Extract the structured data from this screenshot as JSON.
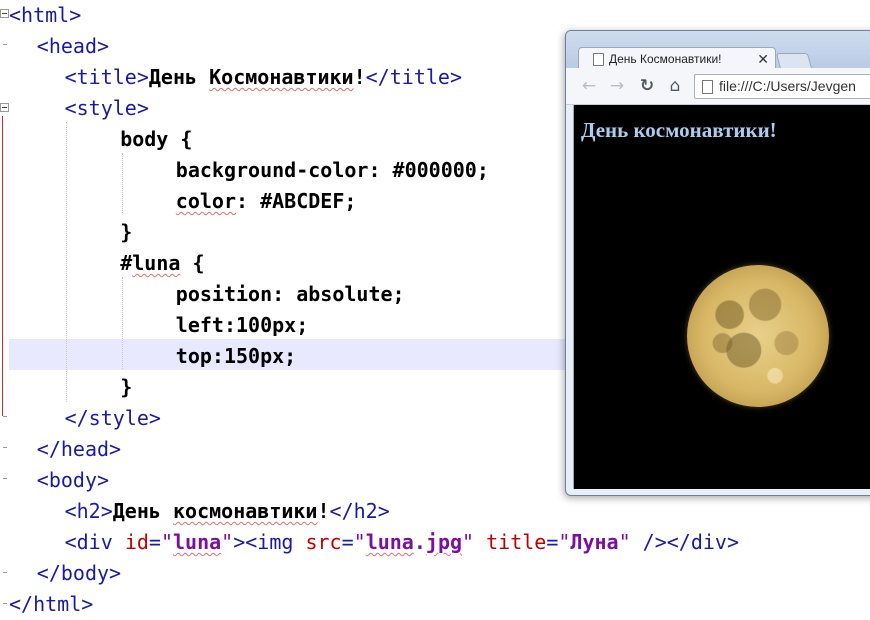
{
  "editor": {
    "lines": [
      {
        "indent": 0,
        "parts": [
          {
            "t": "<html>",
            "c": "tag"
          }
        ]
      },
      {
        "indent": 1,
        "parts": [
          {
            "t": "<head>",
            "c": "tag"
          }
        ]
      },
      {
        "indent": 2,
        "parts": [
          {
            "t": "<title>",
            "c": "tag"
          },
          {
            "t": "День ",
            "c": "strong"
          },
          {
            "t": "Космонавтики",
            "c": "strong sq"
          },
          {
            "t": "!",
            "c": "strong"
          },
          {
            "t": "</title>",
            "c": "tag"
          }
        ]
      },
      {
        "indent": 2,
        "parts": [
          {
            "t": "<style>",
            "c": "tag"
          }
        ]
      },
      {
        "indent": 4,
        "parts": [
          {
            "t": "body {",
            "c": "strong"
          }
        ]
      },
      {
        "indent": 6,
        "parts": [
          {
            "t": "background-color: #000000;",
            "c": "strong"
          }
        ]
      },
      {
        "indent": 6,
        "parts": [
          {
            "t": "color",
            "c": "strong sq"
          },
          {
            "t": ": #ABCDEF;",
            "c": "strong"
          }
        ]
      },
      {
        "indent": 4,
        "parts": [
          {
            "t": "}",
            "c": "strong"
          }
        ]
      },
      {
        "indent": 4,
        "parts": [
          {
            "t": "#",
            "c": "strong"
          },
          {
            "t": "luna",
            "c": "strong sq"
          },
          {
            "t": " {",
            "c": "strong"
          }
        ]
      },
      {
        "indent": 6,
        "parts": [
          {
            "t": "position: absolute;",
            "c": "strong"
          }
        ]
      },
      {
        "indent": 6,
        "parts": [
          {
            "t": "left:100px;",
            "c": "strong"
          }
        ]
      },
      {
        "indent": 6,
        "parts": [
          {
            "t": "top:150px;",
            "c": "strong"
          }
        ]
      },
      {
        "indent": 4,
        "parts": [
          {
            "t": "}",
            "c": "strong"
          }
        ]
      },
      {
        "indent": 2,
        "parts": [
          {
            "t": "</style>",
            "c": "tag"
          }
        ]
      },
      {
        "indent": 1,
        "parts": [
          {
            "t": "</head>",
            "c": "tag"
          }
        ]
      },
      {
        "indent": 1,
        "parts": [
          {
            "t": "<body>",
            "c": "tag"
          }
        ]
      },
      {
        "indent": 2,
        "parts": [
          {
            "t": "<h2>",
            "c": "tag"
          },
          {
            "t": "День ",
            "c": "strong"
          },
          {
            "t": "космонавтики",
            "c": "strong sq"
          },
          {
            "t": "!",
            "c": "strong"
          },
          {
            "t": "</h2>",
            "c": "tag"
          }
        ]
      },
      {
        "indent": 2,
        "parts": [
          {
            "t": "<div ",
            "c": "tag"
          },
          {
            "t": "id",
            "c": "attr"
          },
          {
            "t": "=",
            "c": "tag"
          },
          {
            "t": "\"",
            "c": "str"
          },
          {
            "t": "luna",
            "c": "val sq"
          },
          {
            "t": "\"",
            "c": "str"
          },
          {
            "t": "><img ",
            "c": "tag"
          },
          {
            "t": "src",
            "c": "attr"
          },
          {
            "t": "=",
            "c": "tag"
          },
          {
            "t": "\"",
            "c": "str"
          },
          {
            "t": "luna",
            "c": "val sq"
          },
          {
            "t": ".",
            "c": "val"
          },
          {
            "t": "jpg",
            "c": "val sq"
          },
          {
            "t": "\"",
            "c": "str"
          },
          {
            "t": " title",
            "c": "attr"
          },
          {
            "t": "=",
            "c": "tag"
          },
          {
            "t": "\"",
            "c": "str"
          },
          {
            "t": "Луна",
            "c": "val"
          },
          {
            "t": "\"",
            "c": "str"
          },
          {
            "t": " /></div>",
            "c": "tag"
          }
        ]
      },
      {
        "indent": 1,
        "parts": [
          {
            "t": "</body>",
            "c": "tag"
          }
        ]
      },
      {
        "indent": 0,
        "parts": [
          {
            "t": "</html>",
            "c": "tag"
          }
        ]
      }
    ]
  },
  "browser": {
    "tab_title": "День Космонавтики!",
    "tab_close": "✕",
    "url": "file:///C:/Users/Jevgen",
    "page_heading": "День космонавтики!",
    "image_title": "Луна",
    "icons": {
      "back": "back-arrow-icon",
      "forward": "forward-arrow-icon",
      "reload": "reload-icon",
      "home": "home-icon",
      "page": "page-icon"
    },
    "colors": {
      "page_background": "#000000",
      "page_text": "#ABCDEF"
    }
  }
}
